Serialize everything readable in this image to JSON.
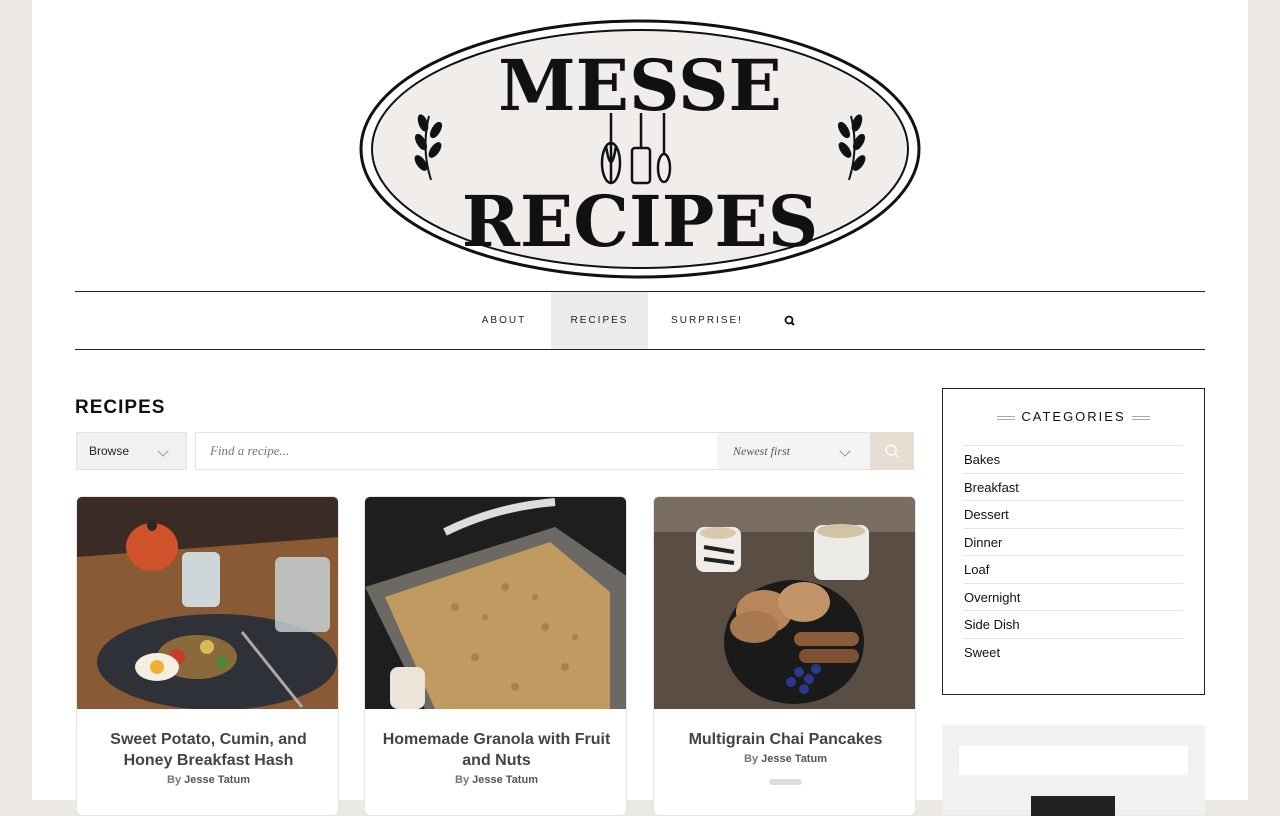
{
  "site": {
    "logo_top": "MESSE",
    "logo_bottom": "RECIPES"
  },
  "nav": {
    "items": [
      {
        "label": "ABOUT",
        "active": false
      },
      {
        "label": "RECIPES",
        "active": true
      },
      {
        "label": "SURPRISE!",
        "active": false
      }
    ],
    "search_icon": "search-icon"
  },
  "main": {
    "title": "RECIPES",
    "browse_label": "Browse",
    "search_placeholder": "Find a recipe...",
    "sort_label": "Newest first"
  },
  "recipes": [
    {
      "title": "Sweet Potato, Cumin, and Honey Breakfast Hash",
      "by": "By",
      "author": "Jesse Tatum"
    },
    {
      "title": "Homemade Granola with Fruit and Nuts",
      "by": "By",
      "author": "Jesse Tatum"
    },
    {
      "title": "Multigrain Chai Pancakes",
      "by": "By",
      "author": "Jesse Tatum"
    }
  ],
  "sidebar": {
    "categories_title": "CATEGORIES",
    "categories": [
      "Bakes",
      "Breakfast",
      "Dessert",
      "Dinner",
      "Loaf",
      "Overnight",
      "Side Dish",
      "Sweet"
    ]
  },
  "colors": {
    "accent": "#e8ddd3",
    "nav_active": "#ebebeb",
    "page_bg": "#ece8e4"
  }
}
